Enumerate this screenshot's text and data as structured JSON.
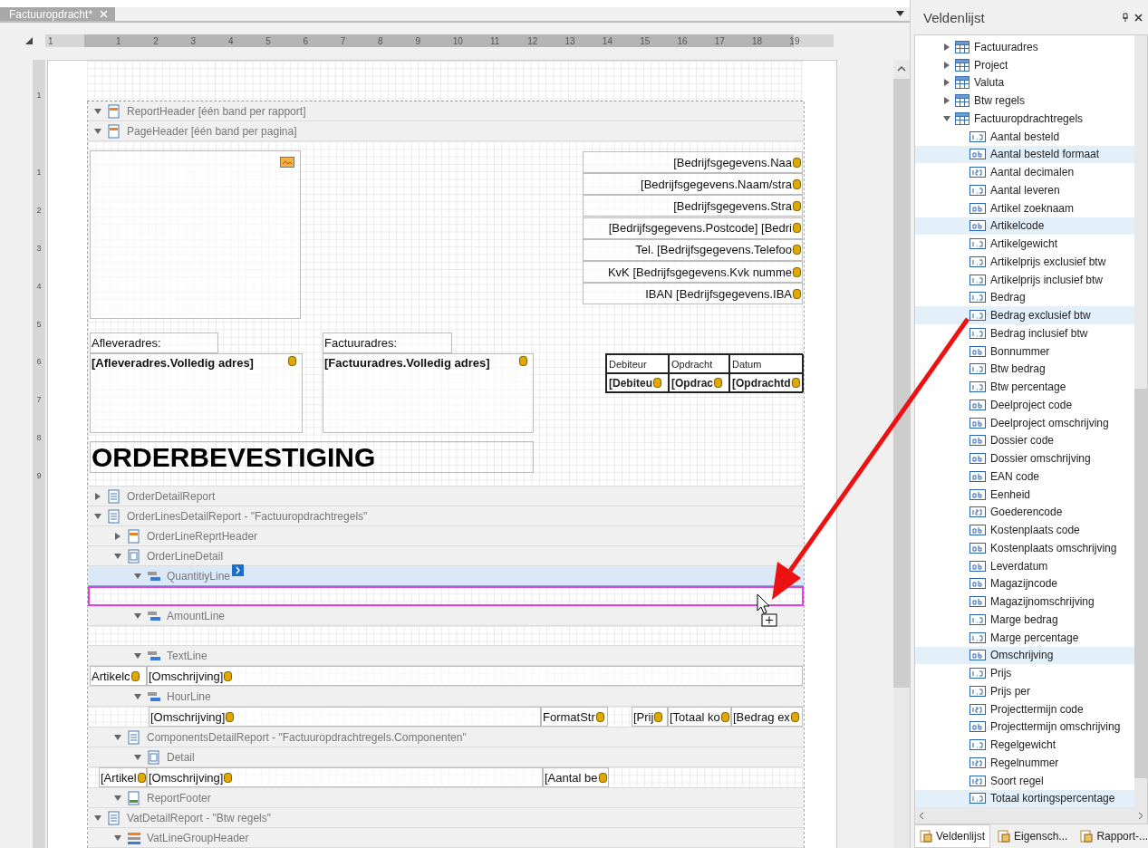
{
  "document_tab": {
    "label": "Factuuropdracht*",
    "selected": true
  },
  "horizontal_ruler": [
    "1",
    "1",
    "2",
    "3",
    "4",
    "5",
    "6",
    "7",
    "8",
    "9",
    "10",
    "11",
    "12",
    "13",
    "14",
    "15",
    "16",
    "17",
    "18",
    "19"
  ],
  "vertical_ruler": [
    "1",
    "1",
    "2",
    "3",
    "4",
    "5",
    "6",
    "7",
    "8",
    "9"
  ],
  "bands": [
    {
      "label": "ReportHeader [één band per rapport]",
      "kind": "header",
      "expanded": true,
      "selected": false
    },
    {
      "label": "PageHeader [één band per pagina]",
      "kind": "header",
      "expanded": true,
      "selected": false,
      "body": {
        "kind": "page_header"
      }
    },
    {
      "label": "OrderDetailReport",
      "kind": "report",
      "expanded": false,
      "selected": false
    },
    {
      "label": "OrderLinesDetailReport - \"Factuuropdrachtregels\"",
      "kind": "report",
      "expanded": true,
      "selected": false,
      "children": [
        {
          "label": "OrderLineReprtHeader",
          "kind": "header",
          "expanded": false,
          "selected": false
        },
        {
          "label": "OrderLineDetail",
          "kind": "detail",
          "expanded": true,
          "selected": false,
          "children": [
            {
              "label": "QuantitiyLine",
              "kind": "subband",
              "expanded": true,
              "selected": true,
              "body": {
                "kind": "empty"
              }
            },
            {
              "label": "AmountLine",
              "kind": "subband",
              "expanded": true,
              "selected": false,
              "body": {
                "kind": "empty"
              }
            },
            {
              "label": "TextLine",
              "kind": "subband",
              "expanded": true,
              "selected": false,
              "body": {
                "kind": "text_line",
                "fields": [
                  "Artikelc",
                  "[Omschrijving]"
                ]
              }
            },
            {
              "label": "HourLine",
              "kind": "subband",
              "expanded": true,
              "selected": false,
              "body": {
                "kind": "hour_line",
                "fields": [
                  "[Omschrijving]",
                  "FormatStr",
                  "[Prij",
                  "[Totaal ko",
                  "[Bedrag ex"
                ]
              }
            }
          ]
        },
        {
          "label": "ComponentsDetailReport - \"Factuuropdrachtregels.Componenten\"",
          "kind": "report",
          "expanded": true,
          "selected": false,
          "children": [
            {
              "label": "Detail",
              "kind": "detail",
              "expanded": true,
              "selected": false,
              "body": {
                "kind": "component_line",
                "fields": [
                  "[Artikel",
                  "[Omschrijving]",
                  "[Aantal be"
                ]
              }
            }
          ]
        },
        {
          "label": "ReportFooter",
          "kind": "footer",
          "expanded": true,
          "selected": false
        }
      ]
    },
    {
      "label": "VatDetailReport - \"Btw regels\"",
      "kind": "report",
      "expanded": true,
      "selected": false,
      "children": [
        {
          "label": "VatLineGroupHeader",
          "kind": "group",
          "expanded": true,
          "selected": false
        }
      ]
    }
  ],
  "page_header": {
    "company_lines": [
      "[Bedrijfsgegevens.Naa",
      "[Bedrijfsgegevens.Naam/stra",
      "[Bedrijfsgegevens.Stra",
      "[Bedrijfsgegevens.Postcode]  [Bedri",
      "Tel. [Bedrijfsgegevens.Telefoo",
      "KvK [Bedrijfsgegevens.Kvk numme",
      "IBAN [Bedrijfsgegevens.IBA"
    ],
    "delivery_label": "Afleveradres:",
    "delivery_field": "[Afleveradres.Volledig adres]",
    "invoice_label": "Factuuradres:",
    "invoice_field": "[Factuuradres.Volledig adres]",
    "info_table": {
      "columns": [
        "Debiteur",
        "Opdracht",
        "Datum"
      ],
      "values": [
        "[Debiteu",
        "[Opdrac",
        "[Opdrachtd"
      ]
    },
    "title": "ORDERBEVESTIGING"
  },
  "field_list": {
    "title": "Veldenlijst",
    "items": [
      {
        "label": "Factuuradres",
        "expanded": false
      },
      {
        "label": "Project",
        "expanded": false
      },
      {
        "label": "Valuta",
        "expanded": false
      },
      {
        "label": "Btw regels",
        "expanded": false
      },
      {
        "label": "Factuuropdrachtregels",
        "expanded": true,
        "children": [
          {
            "label": "Aantal besteld",
            "kind": "number",
            "selected": false
          },
          {
            "label": "Aantal besteld formaat",
            "kind": "text",
            "selected": true
          },
          {
            "label": "Aantal decimalen",
            "kind": "integer",
            "selected": false
          },
          {
            "label": "Aantal leveren",
            "kind": "number",
            "selected": false
          },
          {
            "label": "Artikel zoeknaam",
            "kind": "text",
            "selected": false
          },
          {
            "label": "Artikelcode",
            "kind": "text",
            "selected": true
          },
          {
            "label": "Artikelgewicht",
            "kind": "number",
            "selected": false
          },
          {
            "label": "Artikelprijs exclusief btw",
            "kind": "number",
            "selected": false
          },
          {
            "label": "Artikelprijs inclusief btw",
            "kind": "number",
            "selected": false
          },
          {
            "label": "Bedrag",
            "kind": "number",
            "selected": false
          },
          {
            "label": "Bedrag exclusief btw",
            "kind": "number",
            "selected": true
          },
          {
            "label": "Bedrag inclusief btw",
            "kind": "number",
            "selected": false
          },
          {
            "label": "Bonnummer",
            "kind": "text",
            "selected": false
          },
          {
            "label": "Btw bedrag",
            "kind": "number",
            "selected": false
          },
          {
            "label": "Btw percentage",
            "kind": "number",
            "selected": false
          },
          {
            "label": "Deelproject code",
            "kind": "text",
            "selected": false
          },
          {
            "label": "Deelproject omschrijving",
            "kind": "text",
            "selected": false
          },
          {
            "label": "Dossier code",
            "kind": "text",
            "selected": false
          },
          {
            "label": "Dossier omschrijving",
            "kind": "text",
            "selected": false
          },
          {
            "label": "EAN code",
            "kind": "text",
            "selected": false
          },
          {
            "label": "Eenheid",
            "kind": "text",
            "selected": false
          },
          {
            "label": "Goederencode",
            "kind": "integer",
            "selected": false
          },
          {
            "label": "Kostenplaats code",
            "kind": "text",
            "selected": false
          },
          {
            "label": "Kostenplaats omschrijving",
            "kind": "text",
            "selected": false
          },
          {
            "label": "Leverdatum",
            "kind": "text",
            "selected": false
          },
          {
            "label": "Magazijncode",
            "kind": "text",
            "selected": false
          },
          {
            "label": "Magazijnomschrijving",
            "kind": "text",
            "selected": false
          },
          {
            "label": "Marge bedrag",
            "kind": "number",
            "selected": false
          },
          {
            "label": "Marge percentage",
            "kind": "number",
            "selected": false
          },
          {
            "label": "Omschrijving",
            "kind": "text",
            "selected": true
          },
          {
            "label": "Prijs",
            "kind": "number",
            "selected": false
          },
          {
            "label": "Prijs per",
            "kind": "number",
            "selected": false
          },
          {
            "label": "Projecttermijn code",
            "kind": "integer",
            "selected": false
          },
          {
            "label": "Projecttermijn omschrijving",
            "kind": "text",
            "selected": false
          },
          {
            "label": "Regelgewicht",
            "kind": "number",
            "selected": false
          },
          {
            "label": "Regelnummer",
            "kind": "integer",
            "selected": false
          },
          {
            "label": "Soort regel",
            "kind": "integer",
            "selected": false
          },
          {
            "label": "Totaal kortingspercentage",
            "kind": "number",
            "selected": true
          }
        ]
      }
    ],
    "tabs": [
      {
        "label": "Veldenlijst",
        "selected": true
      },
      {
        "label": "Eigensch...",
        "selected": false
      },
      {
        "label": "Rapport-...",
        "selected": false
      }
    ]
  }
}
